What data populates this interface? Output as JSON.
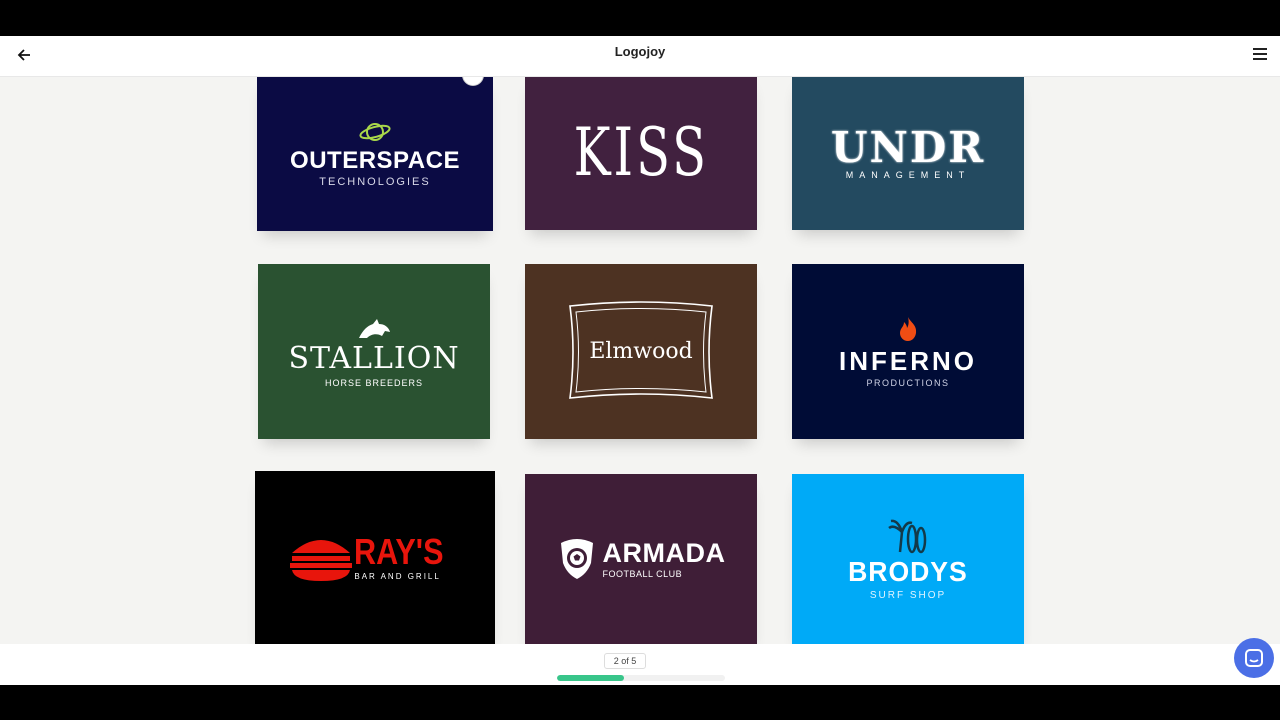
{
  "header": {
    "title": "Logojoy"
  },
  "cards": [
    {
      "main": "OUTERSPACE",
      "sub": "TECHNOLOGIES",
      "bg": "#0b0b44"
    },
    {
      "main": "KISS",
      "sub": "",
      "bg": "#41213f"
    },
    {
      "main": "UNDR",
      "sub": "MANAGEMENT",
      "bg": "#234a60"
    },
    {
      "main": "STALLION",
      "sub": "HORSE BREEDERS",
      "bg": "#2a5231"
    },
    {
      "main": "Elmwood",
      "sub": "",
      "bg": "#4d3222"
    },
    {
      "main": "INFERNO",
      "sub": "PRODUCTIONS",
      "bg": "#000c36"
    },
    {
      "main": "RAY'S",
      "sub": "BAR AND GRILL",
      "bg": "#000000"
    },
    {
      "main": "ARMADA",
      "sub": "FOOTBALL CLUB",
      "bg": "#3f1e37"
    },
    {
      "main": "BRODYS",
      "sub": "SURF SHOP",
      "bg": "#00aaf7"
    }
  ],
  "footer": {
    "page_label": "2 of 5",
    "progress": 0.4
  },
  "icons": [
    "back-arrow-icon",
    "hamburger-menu-icon",
    "planet-icon",
    "horse-head-icon",
    "flame-icon",
    "burger-icon",
    "shield-ball-icon",
    "palm-surfboard-icon",
    "chat-icon"
  ],
  "colors": {
    "progress": "#38c58a",
    "chat": "#4b6fe6",
    "inferno_flame": "#f04d14",
    "rays_red": "#e8150c"
  }
}
